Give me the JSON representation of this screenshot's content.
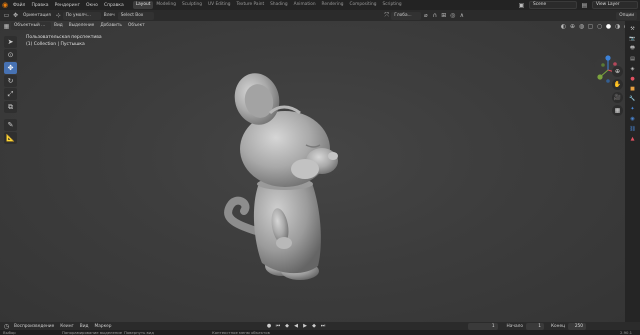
{
  "menu": {
    "items": [
      "Файл",
      "Правка",
      "Рендеринг",
      "Окно",
      "Справка"
    ]
  },
  "workspaces": {
    "tabs": [
      "Layout",
      "Modeling",
      "Sculpting",
      "UV Editing",
      "Texture Paint",
      "Shading",
      "Animation",
      "Rendering",
      "Compositing",
      "Scripting"
    ],
    "active": "Layout"
  },
  "top_right": {
    "scene": "Scene",
    "view_layer": "View Layer"
  },
  "tool_header": {
    "orientation_label": "Ориентация",
    "default_label": "По умолч...",
    "drag_label": "Влеч",
    "select_box": "Select Box",
    "global_label": "Глоба...",
    "options_label": "Опции"
  },
  "view_header": {
    "mode": "Объектный ...",
    "view": "Вид",
    "select": "Выделение",
    "add": "Добавить",
    "object": "Объект"
  },
  "viewport": {
    "perspective_label": "Пользовательская перспектива",
    "collection_label": "(1) Collection | Пустышка"
  },
  "timeline": {
    "playback": "Воспроизведение",
    "keying": "Кеинг",
    "view": "Вид",
    "marker": "Маркер",
    "current_frame": "1",
    "start_label": "Начало",
    "start_value": "1",
    "end_label": "Конец",
    "end_value": "250"
  },
  "statusbar": {
    "select": "Выбор",
    "pan": "Панорамирование выделение",
    "rotate": "Повернуть вид",
    "context": "Контекстное меню объектов",
    "version": "2.90.1"
  },
  "colors": {
    "accent_active_tool": "#4772b3",
    "logo": "#e87d0d",
    "gizmo_x": "#e04a5a",
    "gizmo_y": "#7ba33d",
    "gizmo_z": "#3c82d9"
  }
}
